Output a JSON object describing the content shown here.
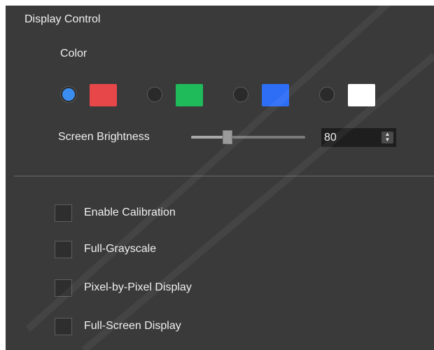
{
  "panel": {
    "title": "Display Control"
  },
  "color_section": {
    "label": "Color",
    "options": [
      {
        "name": "red",
        "swatch": "#e84749",
        "selected": true
      },
      {
        "name": "green",
        "swatch": "#1fbb5a",
        "selected": false
      },
      {
        "name": "blue",
        "swatch": "#2e6ef6",
        "selected": false
      },
      {
        "name": "white",
        "swatch": "#ffffff",
        "selected": false
      }
    ]
  },
  "brightness": {
    "label": "Screen Brightness",
    "value": "80",
    "slider_fraction": 0.32
  },
  "checkboxes": [
    {
      "label": "Enable Calibration",
      "checked": false
    },
    {
      "label": "Full-Grayscale",
      "checked": false
    },
    {
      "label": "Pixel-by-Pixel Display",
      "checked": false
    },
    {
      "label": "Full-Screen Display",
      "checked": false
    }
  ],
  "colors": {
    "panel_bg": "#3a3a3a",
    "radio_selected": "#3b8ef0",
    "text": "#f0f0f0"
  }
}
